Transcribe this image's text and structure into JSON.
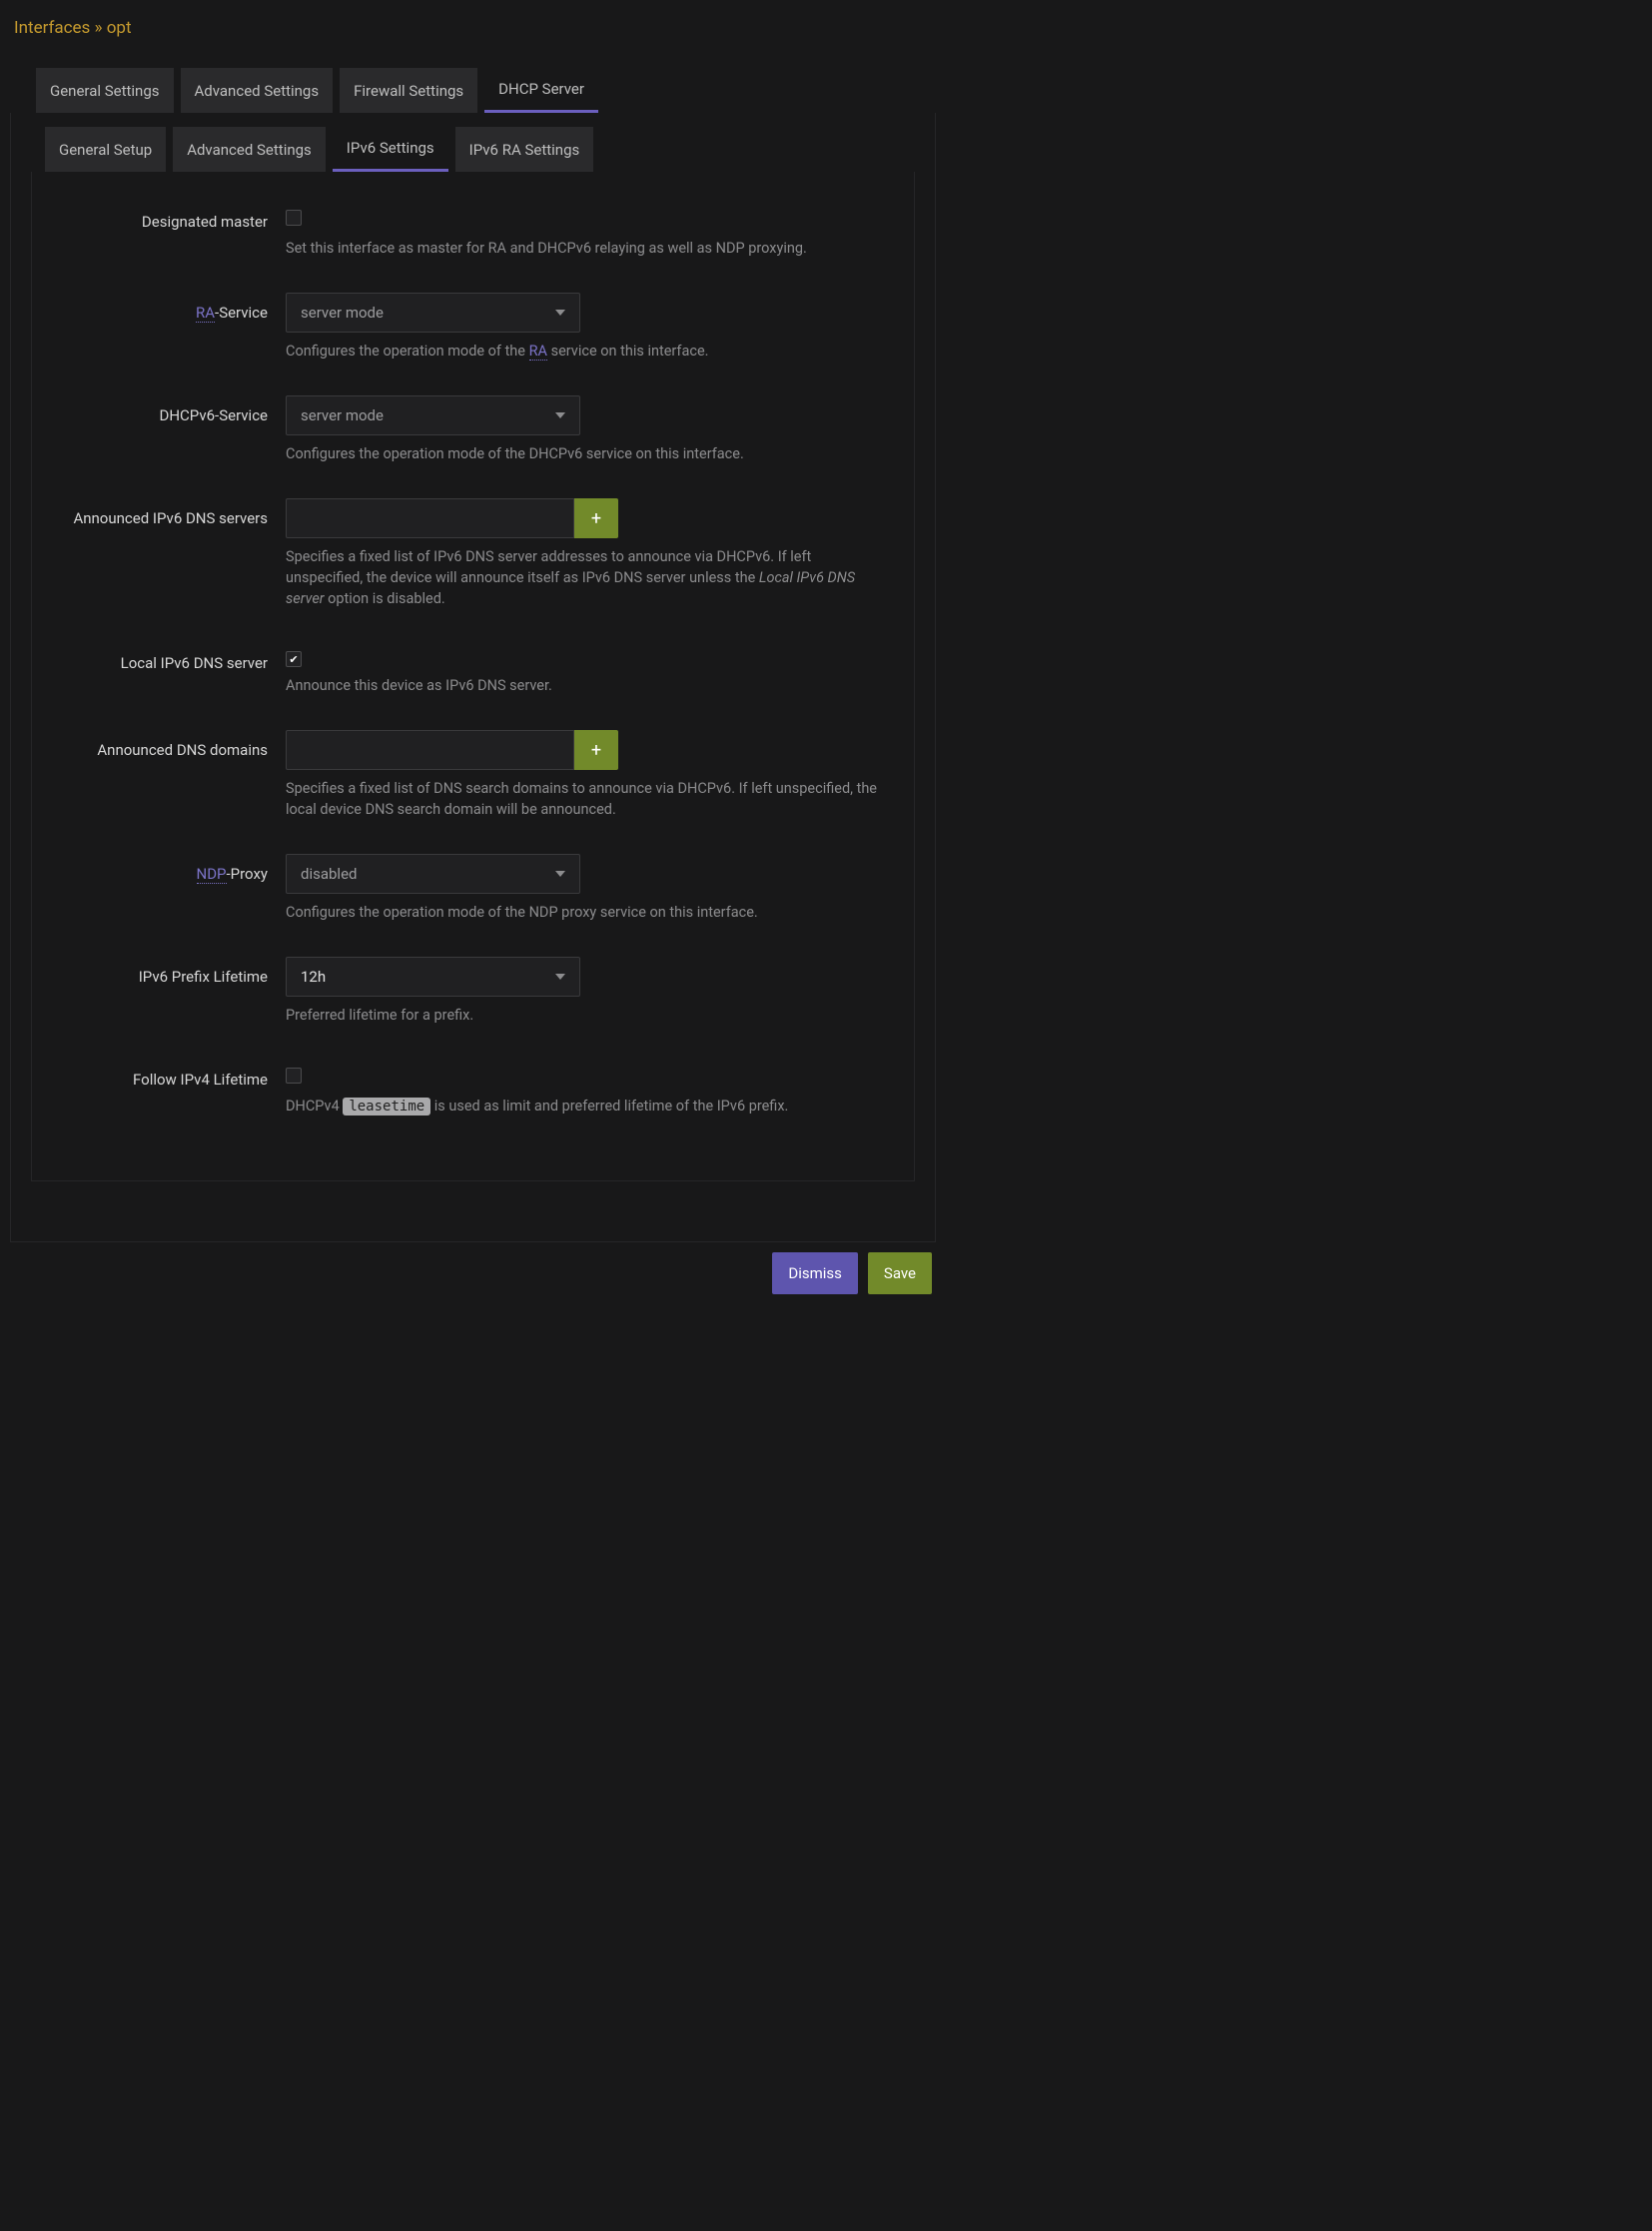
{
  "title": {
    "prefix": "Interfaces",
    "sep": " » ",
    "name": "opt"
  },
  "tabs": {
    "items": [
      "General Settings",
      "Advanced Settings",
      "Firewall Settings",
      "DHCP Server"
    ],
    "active": 3
  },
  "subtabs": {
    "items": [
      "General Setup",
      "Advanced Settings",
      "IPv6 Settings",
      "IPv6 RA Settings"
    ],
    "active": 2
  },
  "fields": {
    "designated_master": {
      "label": "Designated master",
      "checked": false,
      "help": "Set this interface as master for RA and DHCPv6 relaying as well as NDP proxying."
    },
    "ra_service": {
      "label_abbr": "RA",
      "label_rest": "-Service",
      "value": "server mode",
      "help_pre": "Configures the operation mode of the ",
      "help_abbr": "RA",
      "help_post": " service on this interface."
    },
    "dhcpv6_service": {
      "label": "DHCPv6-Service",
      "value": "server mode",
      "help": "Configures the operation mode of the DHCPv6 service on this interface."
    },
    "announced_dns": {
      "label": "Announced IPv6 DNS servers",
      "value": "",
      "add": "+",
      "help_pre": "Specifies a fixed list of IPv6 DNS server addresses to announce via DHCPv6. If left unspecified, the device will announce itself as IPv6 DNS server unless the ",
      "help_em": "Local IPv6 DNS server",
      "help_post": " option is disabled."
    },
    "local_dns": {
      "label": "Local IPv6 DNS server",
      "checked": true,
      "help": "Announce this device as IPv6 DNS server."
    },
    "announced_domains": {
      "label": "Announced DNS domains",
      "value": "",
      "add": "+",
      "help": "Specifies a fixed list of DNS search domains to announce via DHCPv6. If left unspecified, the local device DNS search domain will be announced."
    },
    "ndp_proxy": {
      "label_abbr": "NDP",
      "label_rest": "-Proxy",
      "value": "disabled",
      "help": "Configures the operation mode of the NDP proxy service on this interface."
    },
    "prefix_lifetime": {
      "label": "IPv6 Prefix Lifetime",
      "value": "12h",
      "help": "Preferred lifetime for a prefix."
    },
    "follow_ipv4": {
      "label": "Follow IPv4 Lifetime",
      "checked": false,
      "help_pre": "DHCPv4 ",
      "help_code": "leasetime",
      "help_post": " is used as limit and preferred lifetime of the IPv6 prefix."
    }
  },
  "footer": {
    "dismiss": "Dismiss",
    "save": "Save"
  }
}
